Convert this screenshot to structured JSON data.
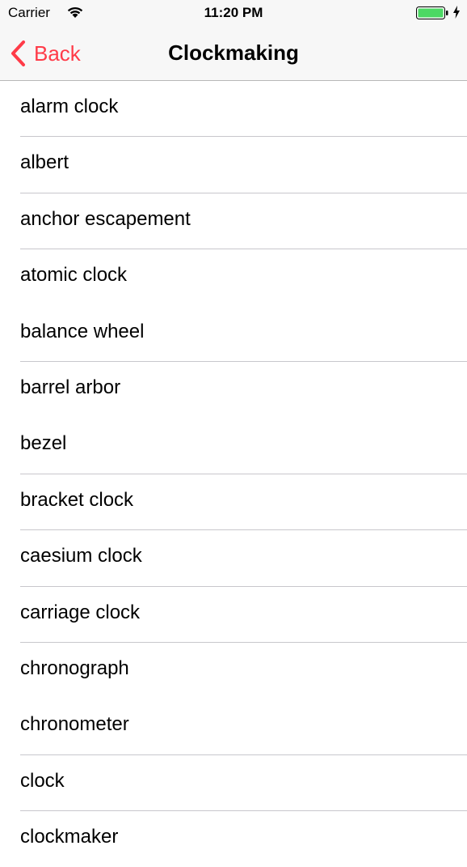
{
  "status_bar": {
    "carrier": "Carrier",
    "time": "11:20 PM",
    "battery_color": "#4cd964"
  },
  "nav": {
    "back_label": "Back",
    "title": "Clockmaking",
    "accent": "#ff3b48"
  },
  "items": [
    {
      "label": "alarm clock"
    },
    {
      "label": "albert"
    },
    {
      "label": "anchor escapement"
    },
    {
      "label": "atomic clock"
    },
    {
      "label": "balance wheel"
    },
    {
      "label": "barrel arbor"
    },
    {
      "label": "bezel"
    },
    {
      "label": "bracket clock"
    },
    {
      "label": "caesium clock"
    },
    {
      "label": "carriage clock"
    },
    {
      "label": "chronograph"
    },
    {
      "label": "chronometer"
    },
    {
      "label": "clock"
    },
    {
      "label": "clockmaker"
    }
  ]
}
